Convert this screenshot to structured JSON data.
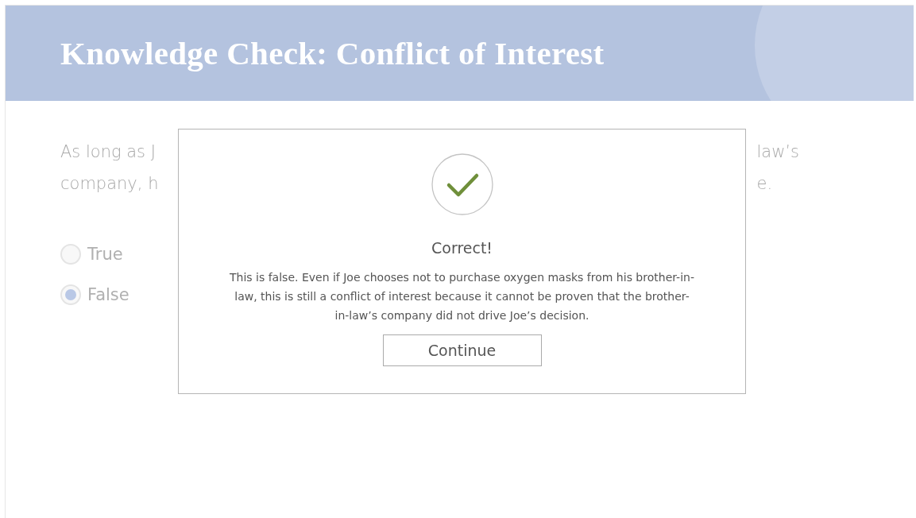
{
  "header": {
    "title": "Knowledge Check: Conflict of Interest"
  },
  "question": {
    "left_lines": [
      "As long as J",
      "company, h"
    ],
    "right_lines": [
      "law’s",
      "e."
    ]
  },
  "options": [
    {
      "label": "True",
      "selected": false
    },
    {
      "label": "False",
      "selected": true
    }
  ],
  "feedback": {
    "correct": true,
    "heading": "Correct!",
    "message": "This is false. Even if Joe chooses not to purchase oxygen masks from his brother-in-law, this is still a conflict of interest because it cannot be proven that the brother-in-law’s company did not drive Joe’s decision.",
    "button": "Continue"
  }
}
